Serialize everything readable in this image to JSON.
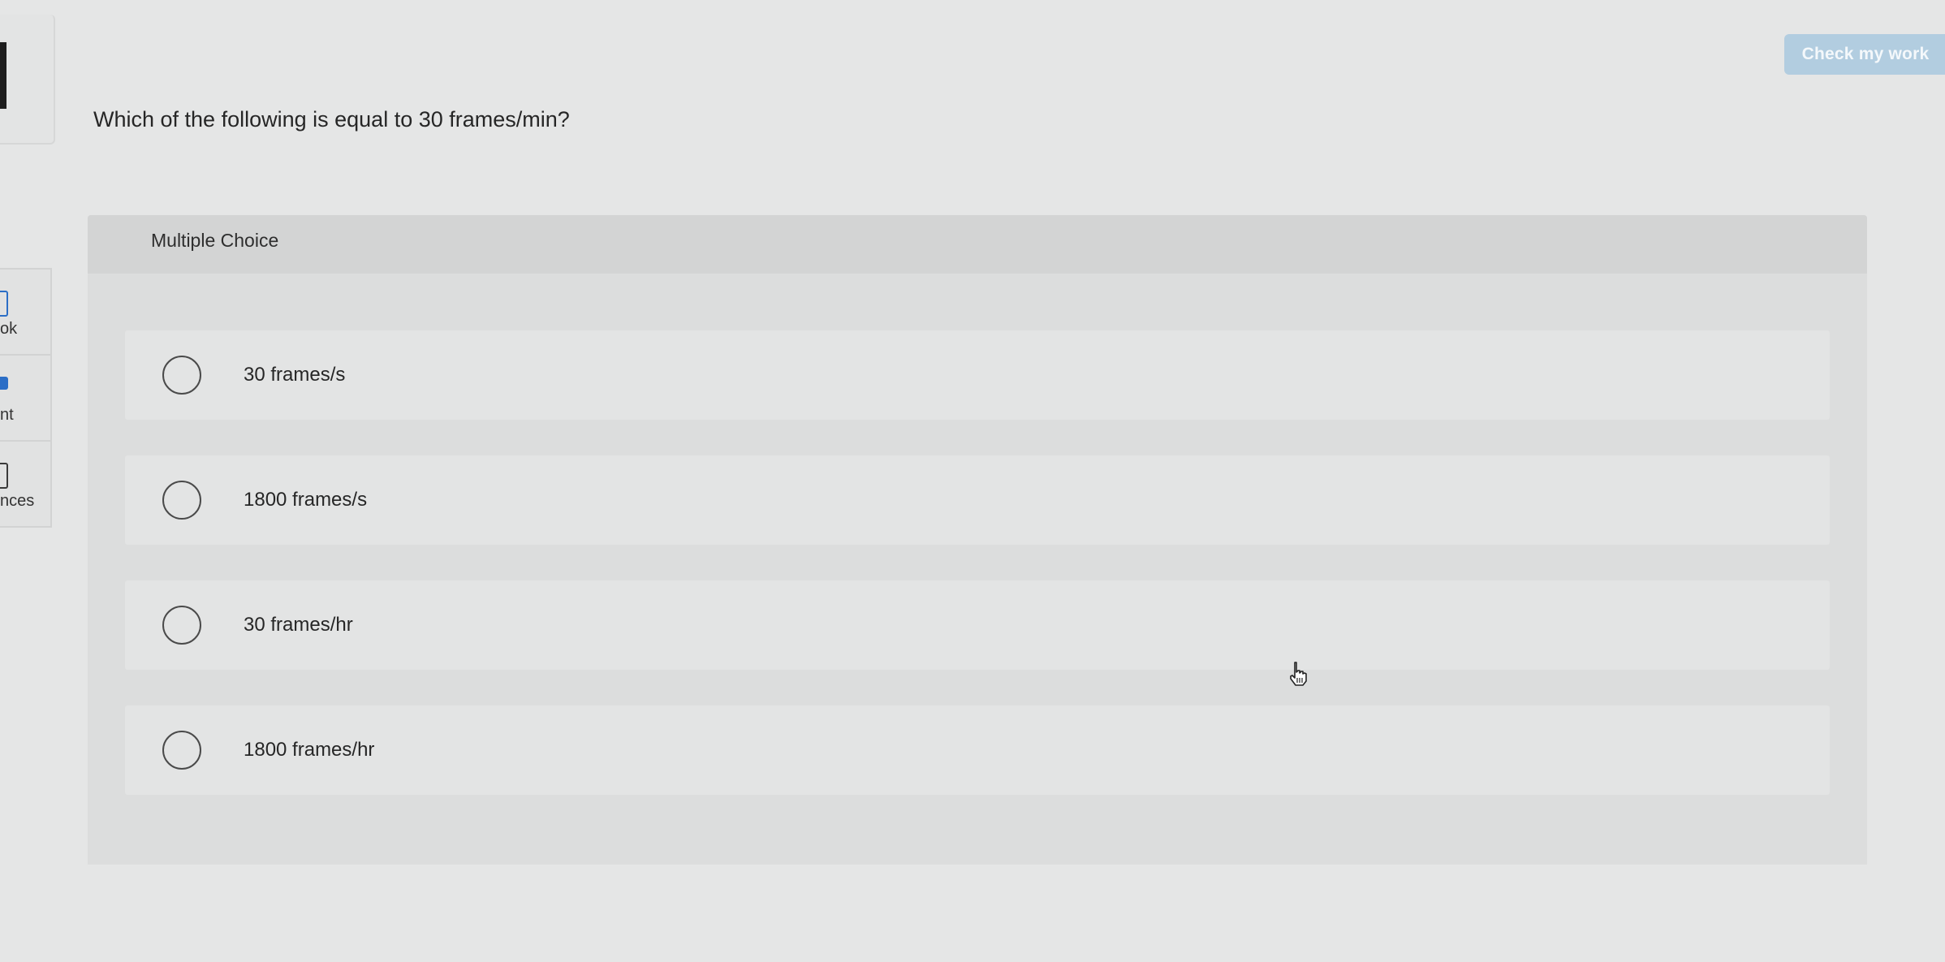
{
  "sidebar": {
    "items": [
      {
        "label": "ok",
        "icon": "book-icon"
      },
      {
        "label": "nt",
        "icon": "print-icon"
      },
      {
        "label": "nces",
        "icon": "references-icon"
      }
    ]
  },
  "toolbar": {
    "check_label": "Check my work"
  },
  "question": {
    "text": "Which of the following is equal to 30 frames/min?"
  },
  "answer_block": {
    "type_label": "Multiple Choice",
    "options": [
      {
        "label": "30 frames/s",
        "selected": false
      },
      {
        "label": "1800 frames/s",
        "selected": false
      },
      {
        "label": "30 frames/hr",
        "selected": false
      },
      {
        "label": "1800 frames/hr",
        "selected": false
      }
    ]
  },
  "colors": {
    "background": "#e5e6e6",
    "check_button": "#b2cde0",
    "accent": "#2b6ec6"
  }
}
